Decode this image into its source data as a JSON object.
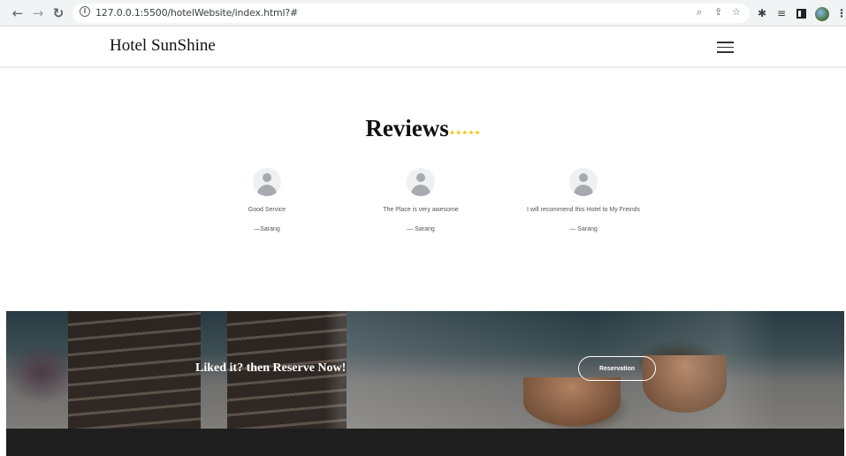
{
  "browser": {
    "url": "127.0.0.1:5500/hotelWebsite/index.html?#",
    "icons": [
      "back-icon",
      "forward-icon",
      "reload-icon",
      "info-icon",
      "zoom-icon",
      "share-icon",
      "bookmark-star-icon",
      "extensions-icon",
      "reading-list-icon",
      "side-panel-icon",
      "profile-avatar",
      "menu-icon"
    ]
  },
  "site": {
    "logo": "Hotel SunShine"
  },
  "reviews": {
    "title": "Reviews",
    "stars": "★★★★★",
    "items": [
      {
        "text": "Good Service",
        "author": "—Sarang"
      },
      {
        "text": "The Place is very awesome",
        "author": "— Sarang"
      },
      {
        "text": "I will recommend this Hotel to My Freinds",
        "author": "— Sarang"
      }
    ]
  },
  "cta": {
    "title": "Liked it? then Reserve Now!",
    "button": "Reservation"
  },
  "colors": {
    "star": "#f5c518",
    "footer": "#1e1e1e"
  }
}
